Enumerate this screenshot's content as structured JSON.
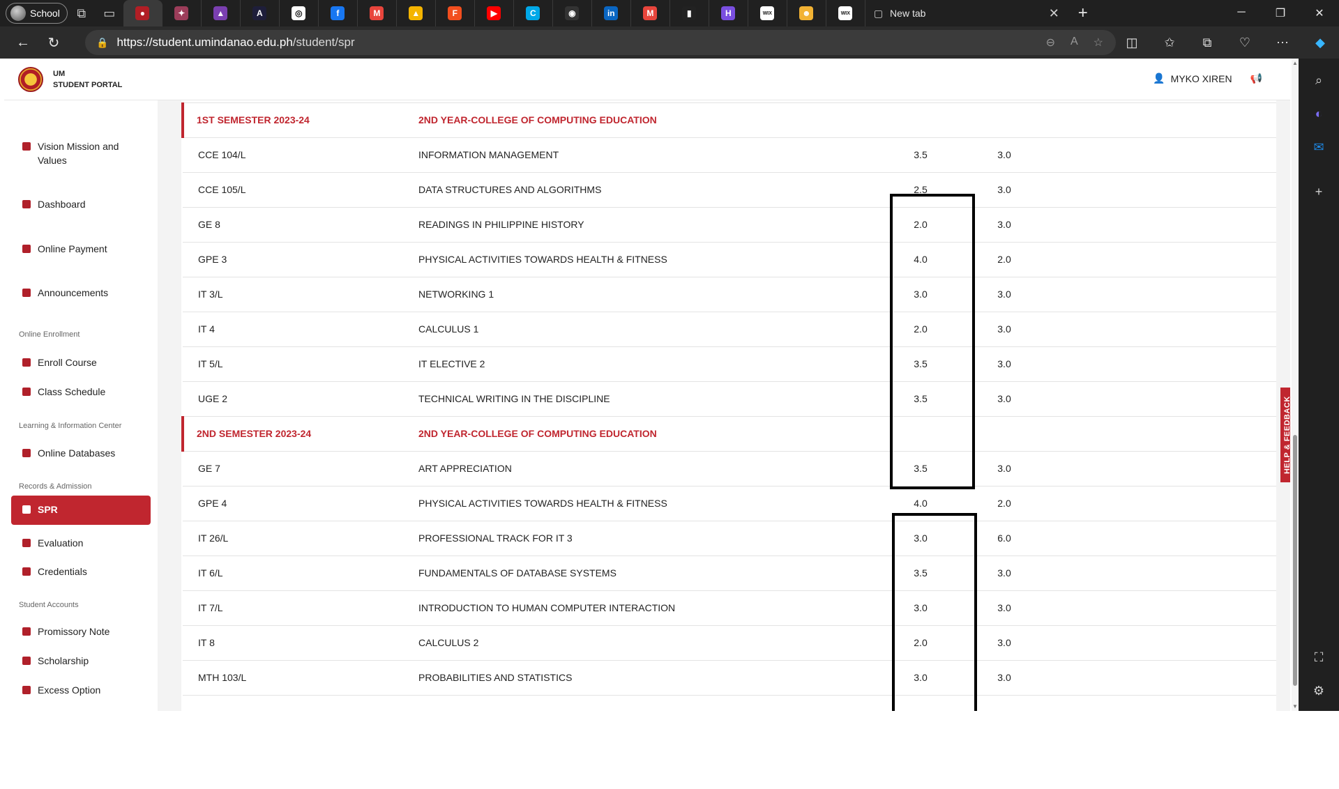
{
  "browser": {
    "profile_label": "School",
    "new_tab_label": "New tab",
    "url_host": "https://student.umindanao.edu.ph",
    "url_path": "/student/spr",
    "tab_favicons": [
      {
        "icon": "um-portal-icon",
        "color": "#b11e25",
        "glyph": "●"
      },
      {
        "icon": "seal-icon",
        "color": "#9c3d5a",
        "glyph": "✦"
      },
      {
        "icon": "hat-icon",
        "color": "#7a3fb0",
        "glyph": "▲"
      },
      {
        "icon": "ai-icon",
        "color": "#1e1e3a",
        "glyph": "A"
      },
      {
        "icon": "chatgpt-icon",
        "color": "#ffffff",
        "glyph": "◎"
      },
      {
        "icon": "facebook-icon",
        "color": "#1877f2",
        "glyph": "f"
      },
      {
        "icon": "gmail-icon",
        "color": "#e8453c",
        "glyph": "M"
      },
      {
        "icon": "drive-icon",
        "color": "#f4b400",
        "glyph": "▲"
      },
      {
        "icon": "figma-icon",
        "color": "#f24e1e",
        "glyph": "F"
      },
      {
        "icon": "youtube-icon",
        "color": "#ff0000",
        "glyph": "▶"
      },
      {
        "icon": "canva-icon",
        "color": "#00a8e8",
        "glyph": "C"
      },
      {
        "icon": "github-icon",
        "color": "#333333",
        "glyph": "◉"
      },
      {
        "icon": "linkedin-icon",
        "color": "#0a66c2",
        "glyph": "in"
      },
      {
        "icon": "gmail-icon",
        "color": "#e8453c",
        "glyph": "M"
      },
      {
        "icon": "chart-icon",
        "color": "#222222",
        "glyph": "▮"
      },
      {
        "icon": "figjam-icon",
        "color": "#7a4fe0",
        "glyph": "H"
      },
      {
        "icon": "wix-icon",
        "color": "#ffffff",
        "glyph": "WIX"
      },
      {
        "icon": "game-icon",
        "color": "#f2b233",
        "glyph": "☻"
      },
      {
        "icon": "wix-icon",
        "color": "#ffffff",
        "glyph": "WIX"
      }
    ]
  },
  "portal": {
    "brand_line1": "UM",
    "brand_line2": "STUDENT PORTAL",
    "user_name": "MYKO XIREN",
    "feedback_label": "HELP & FEEDBACK",
    "accent_color": "#c0262f"
  },
  "sidebar": {
    "items": [
      {
        "label": "Vision Mission and Values",
        "icon": "grid-icon"
      },
      {
        "label": "Dashboard",
        "icon": "grid-icon"
      },
      {
        "label": "Online Payment",
        "icon": "card-icon"
      },
      {
        "label": "Announcements",
        "icon": "megaphone-icon"
      },
      {
        "label": "Enroll Course",
        "icon": "document-icon"
      },
      {
        "label": "Class Schedule",
        "icon": "clipboard-icon"
      },
      {
        "label": "Online Databases",
        "icon": "document-icon"
      },
      {
        "label": "SPR",
        "icon": "document-icon"
      },
      {
        "label": "Evaluation",
        "icon": "clipboard-icon"
      },
      {
        "label": "Credentials",
        "icon": "document-icon"
      },
      {
        "label": "Promissory Note",
        "icon": "edit-icon"
      },
      {
        "label": "Scholarship",
        "icon": "graduation-cap-icon"
      },
      {
        "label": "Excess Option",
        "icon": "arrow-up-icon"
      }
    ],
    "sections": [
      "Online Enrollment",
      "Learning & Information Center",
      "Records & Admission",
      "Student Accounts"
    ]
  },
  "records": {
    "sem1": {
      "term": "1ST SEMESTER 2023-24",
      "program": "2ND YEAR-COLLEGE OF COMPUTING EDUCATION"
    },
    "sem1_rows": [
      {
        "code": "CCE 104/L",
        "desc": "INFORMATION MANAGEMENT",
        "grade": "3.5",
        "units": "3.0"
      },
      {
        "code": "CCE 105/L",
        "desc": "DATA STRUCTURES AND ALGORITHMS",
        "grade": "2.5",
        "units": "3.0"
      },
      {
        "code": "GE 8",
        "desc": "READINGS IN PHILIPPINE HISTORY",
        "grade": "2.0",
        "units": "3.0"
      },
      {
        "code": "GPE 3",
        "desc": "PHYSICAL ACTIVITIES TOWARDS HEALTH & FITNESS",
        "grade": "4.0",
        "units": "2.0"
      },
      {
        "code": "IT 3/L",
        "desc": "NETWORKING 1",
        "grade": "3.0",
        "units": "3.0"
      },
      {
        "code": "IT 4",
        "desc": "CALCULUS 1",
        "grade": "2.0",
        "units": "3.0"
      },
      {
        "code": "IT 5/L",
        "desc": "IT ELECTIVE 2",
        "grade": "3.5",
        "units": "3.0"
      },
      {
        "code": "UGE 2",
        "desc": "TECHNICAL WRITING IN THE DISCIPLINE",
        "grade": "3.5",
        "units": "3.0"
      }
    ],
    "sem2": {
      "term": "2ND SEMESTER 2023-24",
      "program": "2ND YEAR-COLLEGE OF COMPUTING EDUCATION"
    },
    "sem2_rows": [
      {
        "code": "GE 7",
        "desc": "ART APPRECIATION",
        "grade": "3.5",
        "units": "3.0"
      },
      {
        "code": "GPE 4",
        "desc": "PHYSICAL ACTIVITIES TOWARDS HEALTH & FITNESS",
        "grade": "4.0",
        "units": "2.0"
      },
      {
        "code": "IT 26/L",
        "desc": "PROFESSIONAL TRACK FOR IT 3",
        "grade": "3.0",
        "units": "6.0"
      },
      {
        "code": "IT 6/L",
        "desc": "FUNDAMENTALS OF DATABASE SYSTEMS",
        "grade": "3.5",
        "units": "3.0"
      },
      {
        "code": "IT 7/L",
        "desc": "INTRODUCTION TO HUMAN COMPUTER INTERACTION",
        "grade": "3.0",
        "units": "3.0"
      },
      {
        "code": "IT 8",
        "desc": "CALCULUS 2",
        "grade": "2.0",
        "units": "3.0"
      },
      {
        "code": "MTH 103/L",
        "desc": "PROBABILITIES AND STATISTICS",
        "grade": "3.0",
        "units": "3.0"
      }
    ]
  }
}
